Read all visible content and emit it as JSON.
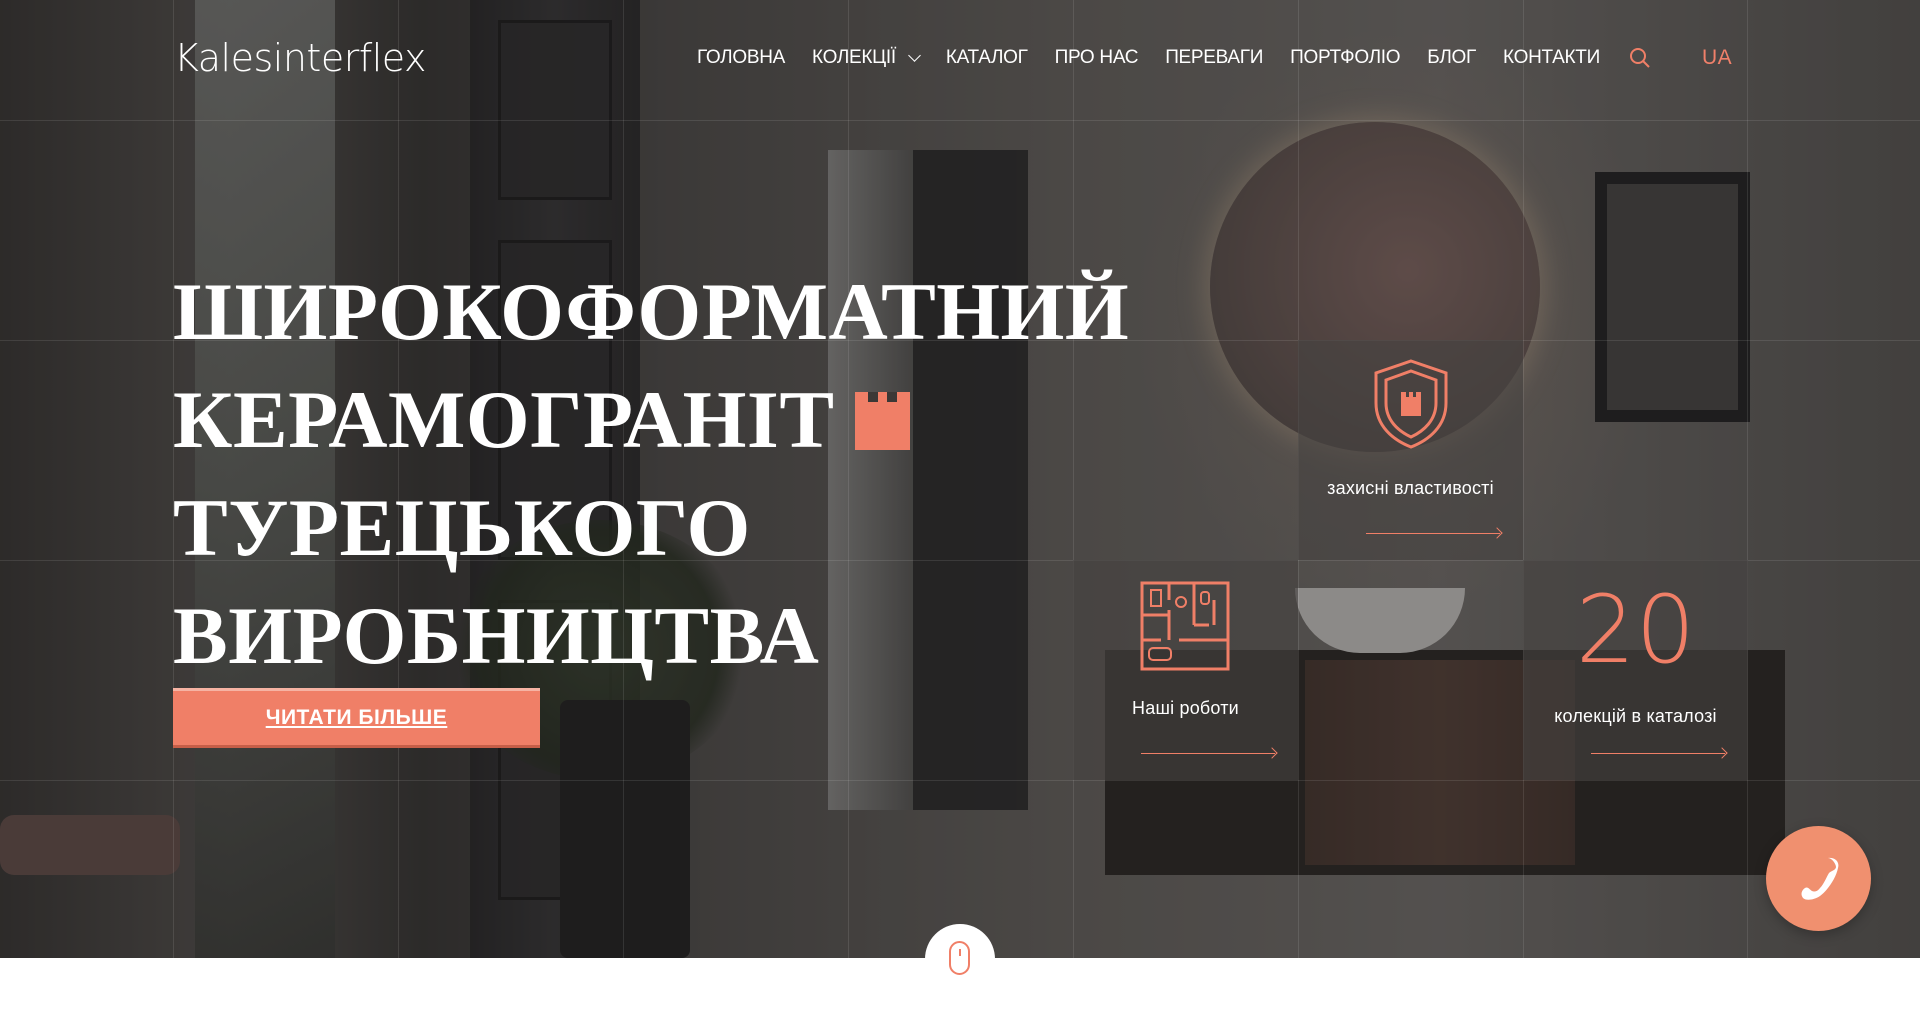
{
  "brand": {
    "logo_text": "Kalesinterflex",
    "accent_color": "#f07f67"
  },
  "nav": {
    "items": [
      {
        "label": "ГОЛОВНА"
      },
      {
        "label": "КОЛЕКЦІЇ",
        "has_dropdown": true
      },
      {
        "label": "КАТАЛОГ"
      },
      {
        "label": "ПРО НАС"
      },
      {
        "label": "ПЕРЕВАГИ"
      },
      {
        "label": "ПОРТФОЛІО"
      },
      {
        "label": "БЛОГ"
      },
      {
        "label": "КОНТАКТИ"
      }
    ],
    "search_icon": "search-icon",
    "language": "UA"
  },
  "hero": {
    "headline_lines": [
      "ШИРОКОФОРМАТНИЙ",
      "КЕРАМОГРАНІТ",
      "ТУРЕЦЬКОГО",
      "ВИРОБНИЦТВА"
    ],
    "cta_label": "ЧИТАТИ БІЛЬШЕ"
  },
  "features": {
    "protection": {
      "label": "захисні властивості",
      "icon": "shield-castle-icon"
    },
    "works": {
      "label": "Наші роботи",
      "icon": "floor-plan-icon"
    },
    "collections": {
      "number": "20",
      "label": "колекцій в каталозі"
    }
  },
  "floating": {
    "phone_icon": "phone-icon",
    "scroll_icon": "mouse-scroll-icon"
  }
}
